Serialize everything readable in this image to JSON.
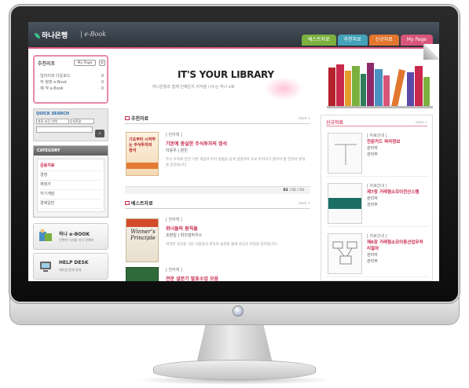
{
  "header": {
    "logo_text": "하나은행",
    "logo_sub": "| e-Book",
    "tabs": [
      "베스트자료",
      "추천자료",
      "신규자료",
      "My Page"
    ]
  },
  "left": {
    "recommend_box": {
      "title": "추천리포",
      "mypage_label": "My Page",
      "items": [
        {
          "label": "· 일라이프 다운로드",
          "value": "0"
        },
        {
          "label": "· 작 정판 e-Book",
          "value": "0"
        },
        {
          "label": "· 예 약 e-Book",
          "value": "0"
        }
      ]
    },
    "quick_search": {
      "title": "QUICK SEARCH",
      "select1": "자료 조건 선택",
      "select2": "자료명"
    },
    "category": {
      "title": "CATEGORY",
      "items": [
        "금융지료",
        "경영",
        "재테크",
        "자기계발",
        "경제일반"
      ]
    },
    "promo1": {
      "title": "하나 e-BOOK",
      "subtitle": "간편한 디지털 지식 전해지"
    },
    "promo2": {
      "title": "HELP DESK",
      "subtitle": "에듀링 문의 안내"
    }
  },
  "hero": {
    "title": "IT'S YOUR LIBRARY",
    "subtitle": "하나은행과 함께 언제든지 지식을 나누는 하나 e북"
  },
  "recommended": {
    "section_label": "추천자료",
    "more": "more +",
    "book": {
      "cover_title": "기초부터 시작하는 주식투자의 정석",
      "tag": "[ 전자책 ]",
      "title": "기본에 충실한 주식투자의 정석",
      "author": "이윤우 | 원진",
      "desc": "주식 투자에 관한 기본 개념과 투자 방법을 쉽게 설명하며 초보 투자자가 알아야 할 전략과 원칙을 담았습니다."
    },
    "pager": {
      "current": "01",
      "rest": "/ 02 / 03"
    }
  },
  "best": {
    "section_label": "베스트자료",
    "more": "more +",
    "book": {
      "cover_title": "Winner's Principle",
      "tag": "[ 전자책 ]",
      "title": "위너들의 원칙들",
      "author": "조현일 | 위즈덤하우스",
      "desc": "위대한 성공을 거둔 사람들의 원칙과 습관을 통해 성공의 비밀을 알아봅니다."
    },
    "book2": {
      "tag": "[ 전자책 ]",
      "title": "전문 설문기 발표수업 모음"
    }
  },
  "new_books": {
    "section_label": "신규자료",
    "more": "more +",
    "items": [
      {
        "tag": "[ 자료안내 ]",
        "title": "전문카드 파라정보",
        "meta1": "관리자",
        "meta2": "관리부"
      },
      {
        "tag": "[ 자료안내 ]",
        "title": "제7장 거래형소모이전산스템",
        "meta1": "관리자",
        "meta2": "관리부"
      },
      {
        "tag": "[ 자료안내 ]",
        "title": "제6장 거래형소모이동선업무처리절차",
        "meta1": "관리자",
        "meta2": "관리부"
      }
    ]
  },
  "colors": {
    "accent_pink": "#d8557a",
    "accent_red": "#c8284c",
    "topbar": "#2d353c"
  }
}
